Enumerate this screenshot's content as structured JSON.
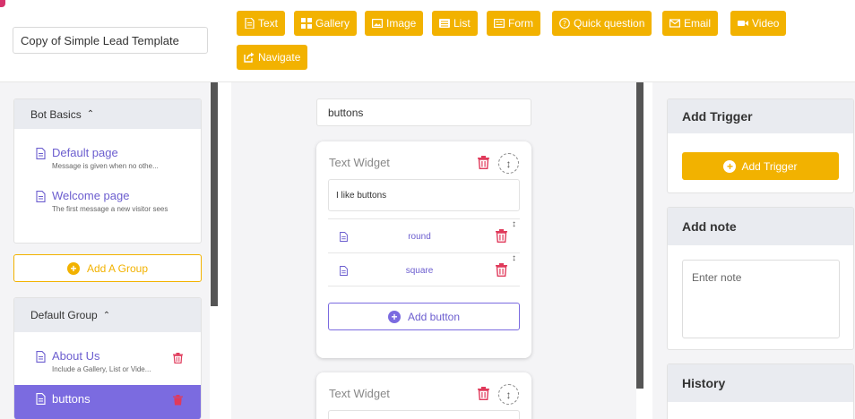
{
  "bot_title": {
    "value": "Copy of Simple Lead Template"
  },
  "toolbar": [
    {
      "label": "Text",
      "icon": "text-icon"
    },
    {
      "label": "Gallery",
      "icon": "gallery-icon"
    },
    {
      "label": "Image",
      "icon": "image-icon"
    },
    {
      "label": "List",
      "icon": "list-icon"
    },
    {
      "label": "Form",
      "icon": "form-icon"
    },
    {
      "label": "Quick question",
      "icon": "question-icon"
    },
    {
      "label": "Email",
      "icon": "email-icon"
    },
    {
      "label": "Video",
      "icon": "video-icon"
    },
    {
      "label": "Navigate",
      "icon": "navigate-icon"
    }
  ],
  "sidebar": {
    "bot_basics": {
      "title": "Bot Basics",
      "items": [
        {
          "title": "Default page",
          "subtitle": "Message is given when no othe..."
        },
        {
          "title": "Welcome page",
          "subtitle": "The first message a new visitor sees"
        }
      ]
    },
    "add_group_label": "Add A Group",
    "default_group": {
      "title": "Default Group",
      "items": [
        {
          "title": "About Us",
          "subtitle": "Include a Gallery, List or Vide..."
        },
        {
          "title": "buttons",
          "subtitle": ""
        }
      ]
    }
  },
  "editor": {
    "page_name": "buttons",
    "widgets": [
      {
        "title": "Text Widget",
        "text": "I like buttons",
        "buttons": [
          {
            "label": "round"
          },
          {
            "label": "square"
          }
        ],
        "add_button_label": "Add button"
      },
      {
        "title": "Text Widget"
      }
    ]
  },
  "right": {
    "trigger": {
      "title": "Add Trigger",
      "button_label": "Add Trigger"
    },
    "note": {
      "title": "Add note",
      "placeholder": "Enter note"
    },
    "history": {
      "title": "History"
    }
  },
  "colors": {
    "accent_yellow": "#f2b200",
    "accent_purple": "#7b6be0",
    "danger_red": "#e03a5b"
  }
}
